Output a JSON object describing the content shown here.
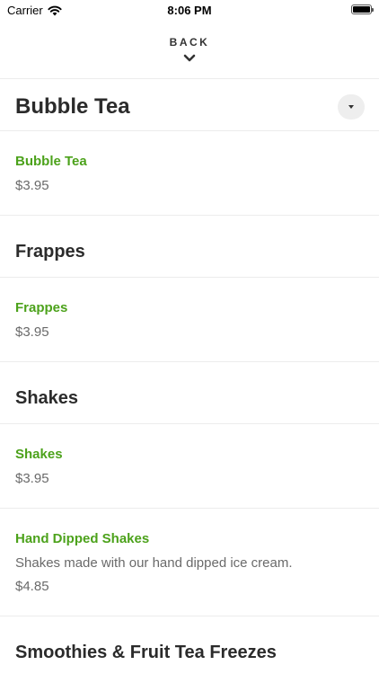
{
  "status_bar": {
    "carrier": "Carrier",
    "time": "8:06 PM"
  },
  "nav": {
    "back_label": "BACK"
  },
  "menu": {
    "sections": [
      {
        "title": "Bubble Tea",
        "items": [
          {
            "name": "Bubble Tea",
            "price": "$3.95"
          }
        ]
      },
      {
        "title": "Frappes",
        "items": [
          {
            "name": "Frappes",
            "price": "$3.95"
          }
        ]
      },
      {
        "title": "Shakes",
        "items": [
          {
            "name": "Shakes",
            "price": "$3.95"
          },
          {
            "name": "Hand Dipped Shakes",
            "description": "Shakes made with our hand dipped ice cream.",
            "price": "$4.85"
          }
        ]
      },
      {
        "title": "Smoothies & Fruit Tea Freezes",
        "items": []
      }
    ]
  },
  "icons": {
    "wifi": "wifi-icon",
    "battery": "battery-icon",
    "back_chevron": "chevron-down-icon",
    "collapse": "caret-down-icon"
  },
  "colors": {
    "item_name": "#4ca21b",
    "text": "#2b2b2b",
    "muted": "#6a6a6a",
    "divider": "#ececec"
  }
}
